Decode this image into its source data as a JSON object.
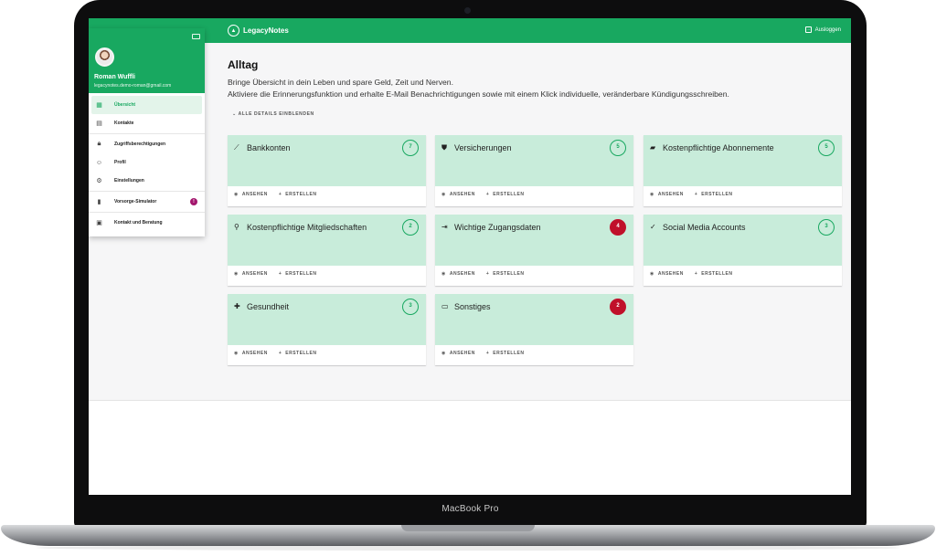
{
  "laptop": {
    "model_label": "MacBook Pro"
  },
  "app": {
    "brand": "LegacyNotes",
    "logout_label": "Ausloggen"
  },
  "user": {
    "name": "Roman Wuffli",
    "email": "legacynotes.demo-roman@gmail.com"
  },
  "nav": {
    "items": [
      {
        "label": "Übersicht",
        "icon": "dashboard-icon"
      },
      {
        "label": "Kontakte",
        "icon": "contact-card-icon"
      },
      {
        "label": "Zugriffsberechtigungen",
        "icon": "lock-icon"
      },
      {
        "label": "Profil",
        "icon": "face-icon"
      },
      {
        "label": "Einstellungen",
        "icon": "gear-icon"
      },
      {
        "label": "Vorsorge-Simulator",
        "icon": "bar-chart-icon",
        "badge": "!"
      },
      {
        "label": "Kontakt und Beratung",
        "icon": "chat-icon"
      }
    ]
  },
  "page": {
    "title": "Alltag",
    "description_line1": "Bringe Übersicht in dein Leben und spare Geld, Zeit und Nerven.",
    "description_line2": "Aktiviere die Erinnerungsfunktion und erhalte E-Mail Benachrichtigungen sowie mit einem Klick individuelle, veränderbare Kündigungsschreiben.",
    "toggle_details": "ALLE DETAILS EINBLENDEN"
  },
  "cards": [
    {
      "title": "Bankkonten",
      "count": "7",
      "icon": "trend-icon",
      "alert": false
    },
    {
      "title": "Versicherungen",
      "count": "5",
      "icon": "shield-icon",
      "alert": false
    },
    {
      "title": "Kostenpflichtige Abonnemente",
      "count": "5",
      "icon": "subscription-icon",
      "alert": false
    },
    {
      "title": "Kostenpflichtige Mitgliedschaften",
      "count": "2",
      "icon": "membership-icon",
      "alert": false
    },
    {
      "title": "Wichtige Zugangsdaten",
      "count": "4",
      "icon": "login-icon",
      "alert": true
    },
    {
      "title": "Social Media Accounts",
      "count": "3",
      "icon": "thumbs-up-icon",
      "alert": false
    },
    {
      "title": "Gesundheit",
      "count": "3",
      "icon": "bandage-icon",
      "alert": false
    },
    {
      "title": "Sonstiges",
      "count": "2",
      "icon": "folder-icon",
      "alert": true
    }
  ],
  "card_actions": {
    "view": "ANSEHEN",
    "create": "ERSTELLEN"
  },
  "colors": {
    "primary": "#18a860",
    "card_bg": "#c8ecda",
    "alert": "#c0102a",
    "badge": "#a3166d"
  }
}
